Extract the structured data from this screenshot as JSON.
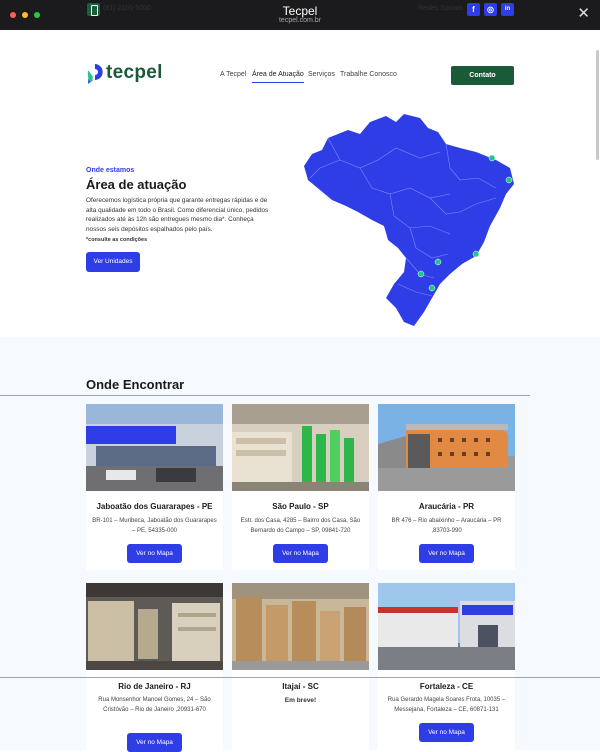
{
  "window": {
    "title": "Tecpel",
    "url": "tecpel.com.br",
    "dots": [
      "#ff5f57",
      "#febc2e",
      "#28c840"
    ]
  },
  "topbar": {
    "phone": "(81) 2101-5000",
    "social_label": "Redes Sociais",
    "social": [
      "f",
      "◎",
      "in"
    ]
  },
  "brand": {
    "name": "tecpel",
    "primary": "#2f3de6",
    "green": "#1b5a38"
  },
  "nav": {
    "items": [
      "A Tecpel",
      "Área de Atuação",
      "Serviços",
      "Trabalhe Conosco"
    ],
    "active": "Área de Atuação",
    "contact": "Contato"
  },
  "hero": {
    "kicker": "Onde estamos",
    "title": "Área de atuação",
    "description": "Oferecemos logística própria que garante entregas rápidas e de alta qualidade em todo o Brasil. Como diferencial único, pedidos realizados até às 12h são entregues mesmo dia*. Conheça nossos seis depósitos espalhados pelo país.",
    "note": "*consulte as condições",
    "button": "Ver Unidades"
  },
  "locations": {
    "title": "Onde Encontrar",
    "items": [
      {
        "name": "Jaboatão dos Guararapes - PE",
        "address": "BR-101 – Muribeca, Jaboatão dos Guararapes – PE, 54335-000",
        "button": "Ver no Mapa"
      },
      {
        "name": "São Paulo - SP",
        "address": "Estr. dos Casa, 4285 – Bairro dos Casa, São Bernardo do Campo – SP, 09841-720",
        "button": "Ver no Mapa"
      },
      {
        "name": "Araucária - PR",
        "address": "BR 476 – Rio abaixinho – Araucária – PR ,83703-990",
        "button": "Ver no Mapa"
      },
      {
        "name": "Rio de Janeiro - RJ",
        "address": "Rua Monsenhor Manoel Gomes, 24 – São Cristóvão – Rio de Janeiro ,20931-670",
        "button": "Ver no Mapa"
      },
      {
        "name": "Itajaí - SC",
        "soon": "Em breve!"
      },
      {
        "name": "Fortaleza - CE",
        "address": "Rua Gerardo Magela Soares Frota, 10035 – Messejana, Fortaleza – CE, 60871-131",
        "button": "Ver no Mapa"
      }
    ]
  }
}
